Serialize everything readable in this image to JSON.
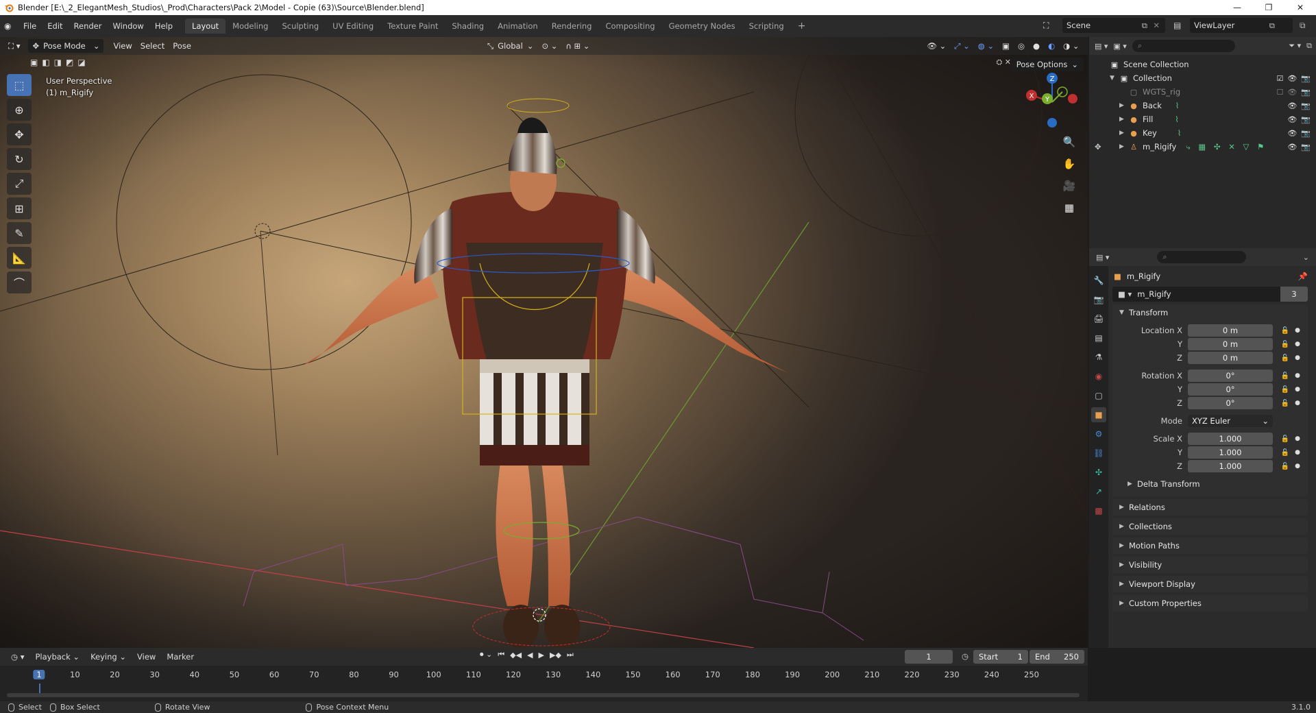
{
  "window": {
    "title": "Blender [E:\\_2_ElegantMesh_Studios\\_Prod\\Characters\\Pack 2\\Model - Copie (63)\\Source\\Blender.blend]",
    "minimize": "—",
    "maximize": "❐",
    "close": "✕"
  },
  "menu": [
    "File",
    "Edit",
    "Render",
    "Window",
    "Help"
  ],
  "workspaces": [
    "Layout",
    "Modeling",
    "Sculpting",
    "UV Editing",
    "Texture Paint",
    "Shading",
    "Animation",
    "Rendering",
    "Compositing",
    "Geometry Nodes",
    "Scripting"
  ],
  "scene": "Scene",
  "view_layer": "ViewLayer",
  "viewport": {
    "mode": "Pose Mode",
    "menus": [
      "View",
      "Select",
      "Pose"
    ],
    "orientation": "Global",
    "pose_options": "Pose Options",
    "perspective": "User Perspective",
    "active": "(1) m_Rigify",
    "gizmo": {
      "z": "Z",
      "y": "Y",
      "x": "X"
    }
  },
  "outliner": {
    "search": "",
    "rows": [
      {
        "label": "Scene Collection",
        "icon": "scene-collection-icon"
      },
      {
        "label": "Collection",
        "icon": "collection-icon"
      },
      {
        "label": "WGTS_rig",
        "icon": "collection-icon"
      },
      {
        "label": "Back",
        "icon": "light-icon"
      },
      {
        "label": "Fill",
        "icon": "light-icon"
      },
      {
        "label": "Key",
        "icon": "light-icon"
      },
      {
        "label": "m_Rigify",
        "icon": "armature-icon"
      }
    ]
  },
  "properties": {
    "search": "",
    "object_name": "m_Rigify",
    "data_name": "m_Rigify",
    "data_users": "3",
    "transform": {
      "title": "Transform",
      "location_label": "Location X",
      "rotation_label": "Rotation X",
      "scale_label": "Scale X",
      "y": "Y",
      "z": "Z",
      "location": [
        "0 m",
        "0 m",
        "0 m"
      ],
      "rotation": [
        "0°",
        "0°",
        "0°"
      ],
      "mode_label": "Mode",
      "mode": "XYZ Euler",
      "scale": [
        "1.000",
        "1.000",
        "1.000"
      ]
    },
    "sections": [
      "Delta Transform",
      "Relations",
      "Collections",
      "Motion Paths",
      "Visibility",
      "Viewport Display",
      "Custom Properties"
    ]
  },
  "timeline": {
    "menus": [
      "Playback",
      "Keying",
      "View",
      "Marker"
    ],
    "current_frame": "1",
    "start_label": "Start",
    "start": "1",
    "end_label": "End",
    "end": "250",
    "ticks": [
      "1",
      "10",
      "20",
      "30",
      "40",
      "50",
      "60",
      "70",
      "80",
      "90",
      "100",
      "110",
      "120",
      "130",
      "140",
      "150",
      "160",
      "170",
      "180",
      "190",
      "200",
      "210",
      "220",
      "230",
      "240",
      "250"
    ]
  },
  "status": {
    "select": "Select",
    "box_select": "Box Select",
    "rotate_view": "Rotate View",
    "context_menu": "Pose Context Menu",
    "version": "3.1.0"
  }
}
